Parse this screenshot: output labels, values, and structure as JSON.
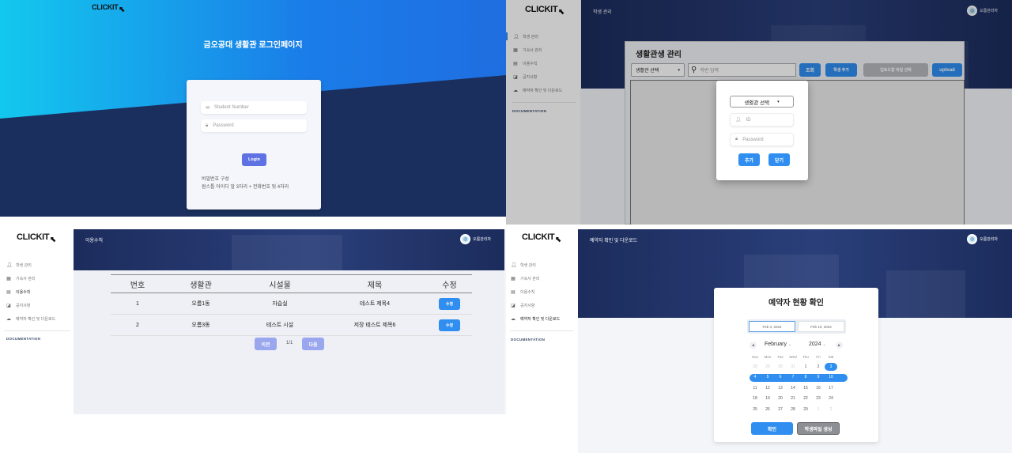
{
  "login": {
    "logo": "CLICKIT",
    "title": "금오공대 생활관 로그인페이지",
    "student_placeholder": "Student Number",
    "password_placeholder": "Password",
    "login_button": "Login",
    "hint_title": "비밀번호 구성",
    "hint_text": "원스톱 아이디 앞 3자리 + 전화번호 뒷 4자리"
  },
  "manage": {
    "logo": "CLICKIT",
    "header_title": "학생 관리",
    "admin_name": "오름관리자",
    "page_title": "생활관생 관리",
    "dorm_select": "생활관 선택",
    "search_placeholder": "학번 입력",
    "search_button": "조회",
    "add_button": "학생 추가",
    "file_button": "업로드할 파일 선택",
    "upload_button": "upload",
    "modal": {
      "dorm_select": "생활관 선택",
      "id_placeholder": "ID",
      "password_placeholder": "Password",
      "add_button": "추가",
      "close_button": "닫기"
    }
  },
  "sidebar": {
    "items": [
      {
        "label": "학생 관리",
        "icon": "user-icon"
      },
      {
        "label": "기숙사 관리",
        "icon": "building-icon"
      },
      {
        "label": "이용수칙",
        "icon": "document-icon"
      },
      {
        "label": "공지사항",
        "icon": "megaphone-icon"
      },
      {
        "label": "예약자 확인 및 다운로드",
        "icon": "cloud-download-icon"
      }
    ],
    "documentation": "DOCUMENTATION"
  },
  "rules": {
    "logo": "CLICKIT",
    "header_title": "이용수칙",
    "admin_name": "오름관리자",
    "columns": [
      "번호",
      "생활관",
      "시설물",
      "제목",
      "수정"
    ],
    "rows": [
      {
        "no": "1",
        "dorm": "오름1동",
        "facility": "자습실",
        "title": "테스트 제목4",
        "edit": "수정"
      },
      {
        "no": "2",
        "dorm": "오름3동",
        "facility": "테스트 시설",
        "title": "저장 테스트 제목6",
        "edit": "수정"
      }
    ],
    "prev": "이전",
    "page": "1/1",
    "next": "다음"
  },
  "reserve": {
    "logo": "CLICKIT",
    "header_title": "예약자 확인 및 다운로드",
    "admin_name": "오름관리자",
    "card_title": "예약자 현황 확인",
    "start_date": "Feb 3, 2024",
    "end_date": "Feb 10, 2024",
    "month": "February",
    "year": "2024",
    "weekdays": [
      "Sun",
      "Mon",
      "Tue",
      "Wed",
      "Thu",
      "Fri",
      "Sat"
    ],
    "weeks": [
      [
        "28",
        "29",
        "30",
        "31",
        "1",
        "2",
        "3"
      ],
      [
        "4",
        "5",
        "6",
        "7",
        "8",
        "9",
        "10"
      ],
      [
        "11",
        "12",
        "13",
        "14",
        "15",
        "16",
        "17"
      ],
      [
        "18",
        "19",
        "20",
        "21",
        "22",
        "23",
        "24"
      ],
      [
        "25",
        "26",
        "27",
        "28",
        "29",
        "1",
        "2"
      ]
    ],
    "confirm_button": "확인",
    "generate_button": "학생파일 생성",
    "accent": "#2f8ef0"
  }
}
